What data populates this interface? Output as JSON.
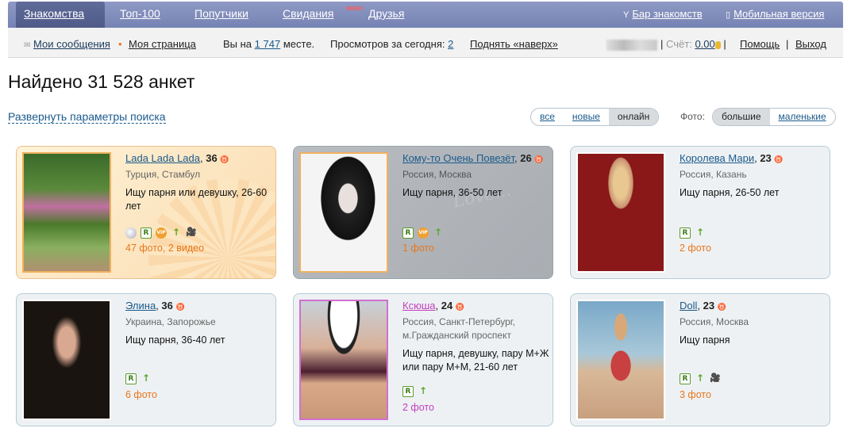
{
  "nav": {
    "items": [
      {
        "label": "Знакомства",
        "active": true
      },
      {
        "label": "Топ-100"
      },
      {
        "label": "Попутчики"
      },
      {
        "label": "Свидания",
        "badge": "NEW!"
      },
      {
        "label": "Друзья"
      }
    ],
    "bar_label": "Бар знакомств",
    "mobile_label": "Мобильная версия"
  },
  "subbar": {
    "messages": "Мои сообщения",
    "my_page": "Моя страница",
    "rank_prefix": "Вы на",
    "rank_value": "1 747",
    "rank_suffix": "месте.",
    "views_label": "Просмотров за сегодня:",
    "views_value": "2",
    "raise": "Поднять «наверх»",
    "score_label": "Счёт:",
    "score_value": "0.00",
    "help": "Помощь",
    "exit": "Выход"
  },
  "page_title": "Найдено 31 528 анкет",
  "expand_link": "Развернуть параметры поиска",
  "filters": {
    "status": [
      "все",
      "новые",
      "онлайн"
    ],
    "status_active": "онлайн",
    "photo_label": "Фото:",
    "photo": [
      "большие",
      "маленькие"
    ],
    "photo_active": "большие"
  },
  "colors": {
    "nav": "#7683b3",
    "accent_orange": "#e8761c",
    "link": "#1a5a8c",
    "pink": "#c040c0"
  },
  "profiles": [
    {
      "name": "Lada Lada Lada",
      "age": "36",
      "place": "Турция, Стамбул",
      "seek": "Ищу парня или девушку, 26-60 лет",
      "count": "47 фото, 2 видео",
      "style": "gold"
    },
    {
      "name": "Кому-то Очень Повезёт",
      "age": "26",
      "place": "Россия, Москва",
      "seek": "Ищу парня, 36-50 лет",
      "count": "1 фото",
      "style": "dark"
    },
    {
      "name": "Королева Мари",
      "age": "23",
      "place": "Россия, Казань",
      "seek": "Ищу парня, 26-50 лет",
      "count": "2 фото",
      "style": "plain"
    },
    {
      "name": "Элина",
      "age": "36",
      "place": "Украина, Запорожье",
      "seek": "Ищу парня, 36-40 лет",
      "count": "6 фото",
      "style": "plain"
    },
    {
      "name": "Ксюша",
      "age": "24",
      "place": "Россия, Санкт-Петербург, м.Гражданский проспект",
      "seek": "Ищу парня, девушку, пару М+Ж или пару М+М, 21-60 лет",
      "count": "2 фото",
      "style": "pink"
    },
    {
      "name": "Doll",
      "age": "23",
      "place": "Россия, Москва",
      "seek": "Ищу парня",
      "count": "3 фото",
      "style": "plain"
    }
  ]
}
